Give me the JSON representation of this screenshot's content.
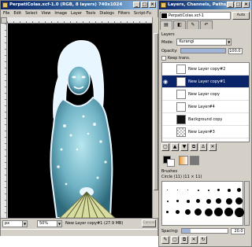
{
  "image_window": {
    "title": "PerpatiColas.xcf-1.0 (RGB, 8 layers) 740x1024",
    "menu": [
      "File",
      "Edit",
      "Select",
      "View",
      "Image",
      "Layer",
      "Tools",
      "Dialogs",
      "Filters",
      "Script-Fu"
    ],
    "status": {
      "unit": "px",
      "zoom": "50%",
      "message": "New Layer copy#1 (27.9 MB)",
      "cancel_label": "Cancel"
    }
  },
  "dock": {
    "title": "Layers, Channels, Paths, Undo...",
    "image_selector": "PerpatiColas.xcf-1",
    "auto_label": "Auto",
    "panel_title": "Layers",
    "mode_label": "Mode:",
    "mode_value": "Kurangi",
    "opacity_label": "Opacity:",
    "opacity_value": "100.0",
    "opacity_fraction": 1.0,
    "keep_trans_label": "Keep trans.",
    "layers": [
      {
        "name": "New Layer copy#2",
        "visible": false,
        "thumb": "light",
        "selected": false
      },
      {
        "name": "New Layer copy#1",
        "visible": true,
        "thumb": "light",
        "selected": true
      },
      {
        "name": "New Layer copy",
        "visible": false,
        "thumb": "light",
        "selected": false
      },
      {
        "name": "New Layer#4",
        "visible": false,
        "thumb": "light",
        "selected": false
      },
      {
        "name": "Background copy",
        "visible": false,
        "thumb": "dark",
        "selected": false
      },
      {
        "name": "New Layer#3",
        "visible": false,
        "thumb": "check",
        "selected": false
      }
    ],
    "layer_buttons": [
      "new-layer",
      "raise-layer",
      "lower-layer",
      "duplicate-layer",
      "anchor-layer",
      "delete-layer"
    ],
    "layer_button_glyphs": [
      "▢",
      "▲",
      "▼",
      "⧉",
      "⚓",
      "✕"
    ],
    "brushes_title": "Brushes",
    "brush_name": "Circle (11) (11 × 11)",
    "spacing_label": "Spacing:",
    "spacing_value": "20.0",
    "brush_button_glyphs": [
      "✎",
      "▢",
      "⧉",
      "✕",
      "↻"
    ]
  },
  "colors": {
    "title_start": "#0a246a",
    "title_end": "#a6caf0",
    "selection": "#0a246a",
    "canvas_bg": "#000000",
    "figure_edge": "#e6f4ff",
    "figure_fill": "#8fc8d8",
    "fan": "#d8dca0"
  }
}
